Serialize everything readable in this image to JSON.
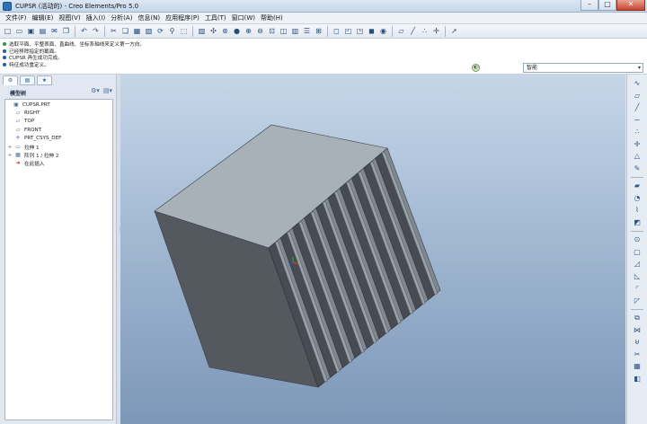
{
  "window": {
    "title": "CUPSR (活动的) - Creo Elements/Pro 5.0",
    "controls": {
      "minimize": "–",
      "maximize": "□",
      "close": "✕"
    }
  },
  "menu": [
    "文件(F)",
    "编辑(E)",
    "视图(V)",
    "插入(I)",
    "分析(A)",
    "信息(N)",
    "应用程序(P)",
    "工具(T)",
    "窗口(W)",
    "帮助(H)"
  ],
  "toolbar": {
    "groups": [
      [
        "new-icon",
        "open-icon",
        "save-icon",
        "print-icon",
        "email-icon",
        "copy-file-icon"
      ],
      [
        "undo-icon",
        "redo-icon"
      ],
      [
        "cut-icon",
        "copy-icon",
        "paste-icon",
        "paste-special-icon",
        "regenerate-icon",
        "find-icon",
        "select-box-icon"
      ],
      [
        "repaint-icon",
        "spin-center-icon",
        "orient-mode-icon",
        "appearance-icon",
        "zoom-in-icon",
        "zoom-out-icon",
        "refit-icon",
        "reorient-icon",
        "saved-views-icon",
        "layers-icon",
        "view-manager-icon"
      ],
      [
        "wireframe-icon",
        "hidden-line-icon",
        "no-hidden-icon",
        "shading-icon",
        "enhanced-realism-icon"
      ],
      [
        "datum-planes-icon",
        "datum-axes-icon",
        "datum-points-icon",
        "csys-icon"
      ],
      [
        "context-help-icon"
      ]
    ],
    "glyphs": {
      "new-icon": "□",
      "open-icon": "▭",
      "save-icon": "▣",
      "print-icon": "▤",
      "email-icon": "✉",
      "copy-file-icon": "❐",
      "undo-icon": "↶",
      "redo-icon": "↷",
      "cut-icon": "✂",
      "copy-icon": "❏",
      "paste-icon": "▦",
      "paste-special-icon": "▧",
      "regenerate-icon": "⟳",
      "find-icon": "⚲",
      "select-box-icon": "⬚",
      "repaint-icon": "▨",
      "spin-center-icon": "✣",
      "orient-mode-icon": "⊛",
      "appearance-icon": "●",
      "zoom-in-icon": "⊕",
      "zoom-out-icon": "⊖",
      "refit-icon": "⊡",
      "reorient-icon": "◫",
      "saved-views-icon": "▥",
      "layers-icon": "☰",
      "view-manager-icon": "⊞",
      "wireframe-icon": "◻",
      "hidden-line-icon": "◰",
      "no-hidden-icon": "◳",
      "shading-icon": "◼",
      "enhanced-realism-icon": "◉",
      "datum-planes-icon": "▱",
      "datum-axes-icon": "╱",
      "datum-points-icon": "∴",
      "csys-icon": "✛",
      "context-help-icon": "➚"
    }
  },
  "messages": [
    {
      "text": "选取平面、平整表面、直曲线、坐标系轴线来定义第一方向。",
      "bullet": "green"
    },
    {
      "text": "已经移除指定的截面。",
      "bullet": "blue"
    },
    {
      "text": "CUPSR 再生成功完成。",
      "bullet": "blue"
    },
    {
      "text": "特征成功重定义。",
      "bullet": "blue"
    }
  ],
  "status": {
    "icon": "smart-filter-status-icon",
    "glyph": "◐"
  },
  "filter": {
    "value": "智能",
    "arrow": "▾"
  },
  "nav": {
    "tabs": [
      {
        "name": "model-tree-tab",
        "glyph": "⚙"
      },
      {
        "name": "folder-browser-tab",
        "glyph": "▤"
      },
      {
        "name": "favorites-tab",
        "glyph": "★"
      }
    ],
    "tree_title": "模型树",
    "tree_tools": {
      "settings": "⚙▾",
      "show": "▤▾"
    },
    "tree_items": [
      {
        "label": "CUPSR.PRT",
        "icon": "part-icon",
        "glyph": "▣",
        "indent": 0,
        "expander": ""
      },
      {
        "label": "RIGHT",
        "icon": "datum-plane-icon",
        "glyph": "▱",
        "indent": 1,
        "expander": ""
      },
      {
        "label": "TOP",
        "icon": "datum-plane-icon",
        "glyph": "▱",
        "indent": 1,
        "expander": ""
      },
      {
        "label": "FRONT",
        "icon": "datum-plane-icon",
        "glyph": "▱",
        "indent": 1,
        "expander": ""
      },
      {
        "label": "PRT_CSYS_DEF",
        "icon": "csys-icon",
        "glyph": "✛",
        "indent": 1,
        "expander": ""
      },
      {
        "label": "拉伸 1",
        "icon": "extrude-icon",
        "glyph": "▭",
        "indent": 1,
        "expander": "+"
      },
      {
        "label": "阵列 1 / 拉伸 2",
        "icon": "pattern-icon",
        "glyph": "▦",
        "indent": 1,
        "expander": "+"
      },
      {
        "label": "在此插入",
        "icon": "insert-here-icon",
        "glyph": "➜",
        "indent": 1,
        "expander": "",
        "red": true
      }
    ]
  },
  "right_toolbar": {
    "groups": [
      [
        "sketch-icon",
        "plane-icon",
        "axis-icon",
        "curve-icon",
        "point-icon",
        "csys-datum-icon",
        "analysis-icon",
        "sketched-curve-icon"
      ],
      [
        "extrude-icon",
        "revolve-icon",
        "sweep-icon",
        "blend-icon"
      ],
      [
        "hole-icon",
        "shell-icon",
        "rib-icon",
        "draft-icon",
        "round-icon",
        "chamfer-icon"
      ],
      [
        "copy-feature-icon",
        "mirror-icon",
        "merge-icon",
        "trim-icon",
        "pattern-icon",
        "solidify-icon"
      ]
    ],
    "glyphs": {
      "sketch-icon": "∿",
      "plane-icon": "▱",
      "axis-icon": "╱",
      "curve-icon": "∼",
      "point-icon": "∴",
      "csys-datum-icon": "✛",
      "analysis-icon": "△",
      "sketched-curve-icon": "✎",
      "extrude-icon": "▰",
      "revolve-icon": "◔",
      "sweep-icon": "⌇",
      "blend-icon": "◩",
      "hole-icon": "⊙",
      "shell-icon": "▢",
      "rib-icon": "◿",
      "draft-icon": "◺",
      "round-icon": "◜",
      "chamfer-icon": "◸",
      "copy-feature-icon": "⧉",
      "mirror-icon": "⋈",
      "merge-icon": "⊌",
      "trim-icon": "✂",
      "pattern-icon": "▦",
      "solidify-icon": "◧"
    }
  },
  "colors": {
    "top_face": "#a9b1b8",
    "front_face": "#54595f",
    "fin_face": "#474c52",
    "fin_top": "#9aa2aa",
    "background_top": "#c6d6e8",
    "background_bottom": "#7d97b8"
  }
}
